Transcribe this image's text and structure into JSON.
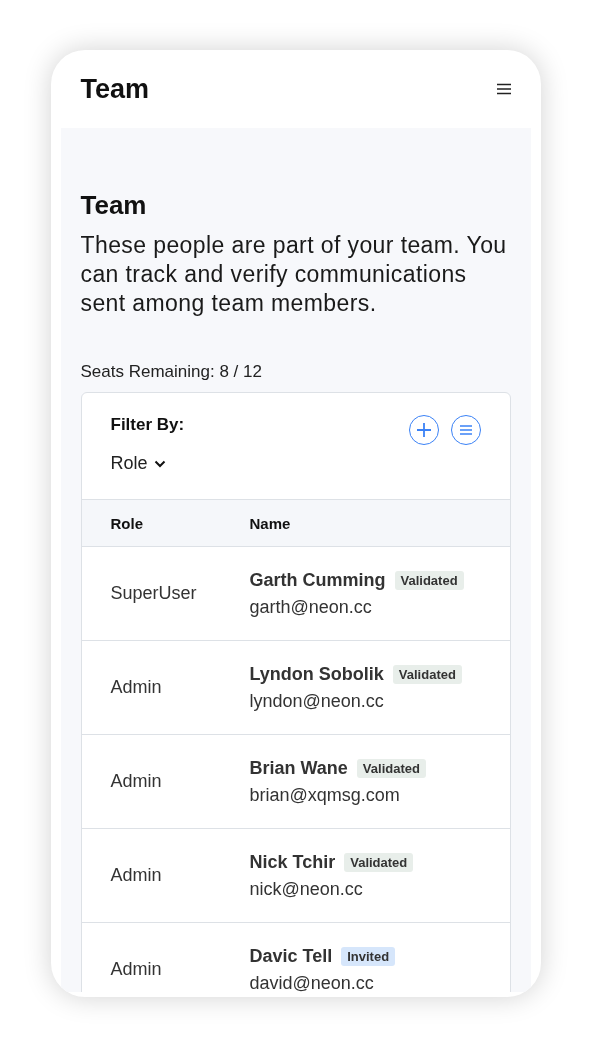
{
  "header": {
    "title": "Team"
  },
  "page": {
    "title": "Team",
    "description": "These people are part of your team. You can track and verify communications sent among team members.",
    "seats": "Seats Remaining: 8 / 12"
  },
  "filter": {
    "label": "Filter By:",
    "dropdown": "Role"
  },
  "table": {
    "columns": [
      "Role",
      "Name"
    ],
    "rows": [
      {
        "role": "SuperUser",
        "name": "Garth Cumming",
        "email": "garth@neon.cc",
        "status": {
          "label": "Validated",
          "kind": "validated"
        }
      },
      {
        "role": "Admin",
        "name": "Lyndon Sobolik",
        "email": "lyndon@neon.cc",
        "status": {
          "label": "Validated",
          "kind": "validated"
        }
      },
      {
        "role": "Admin",
        "name": "Brian Wane",
        "email": "brian@xqmsg.com",
        "status": {
          "label": "Validated",
          "kind": "validated"
        }
      },
      {
        "role": "Admin",
        "name": "Nick Tchir",
        "email": "nick@neon.cc",
        "status": {
          "label": "Validated",
          "kind": "validated"
        }
      },
      {
        "role": "Admin",
        "name": "Davic Tell",
        "email": "david@neon.cc",
        "status": {
          "label": "Invited",
          "kind": "invited"
        }
      }
    ]
  }
}
